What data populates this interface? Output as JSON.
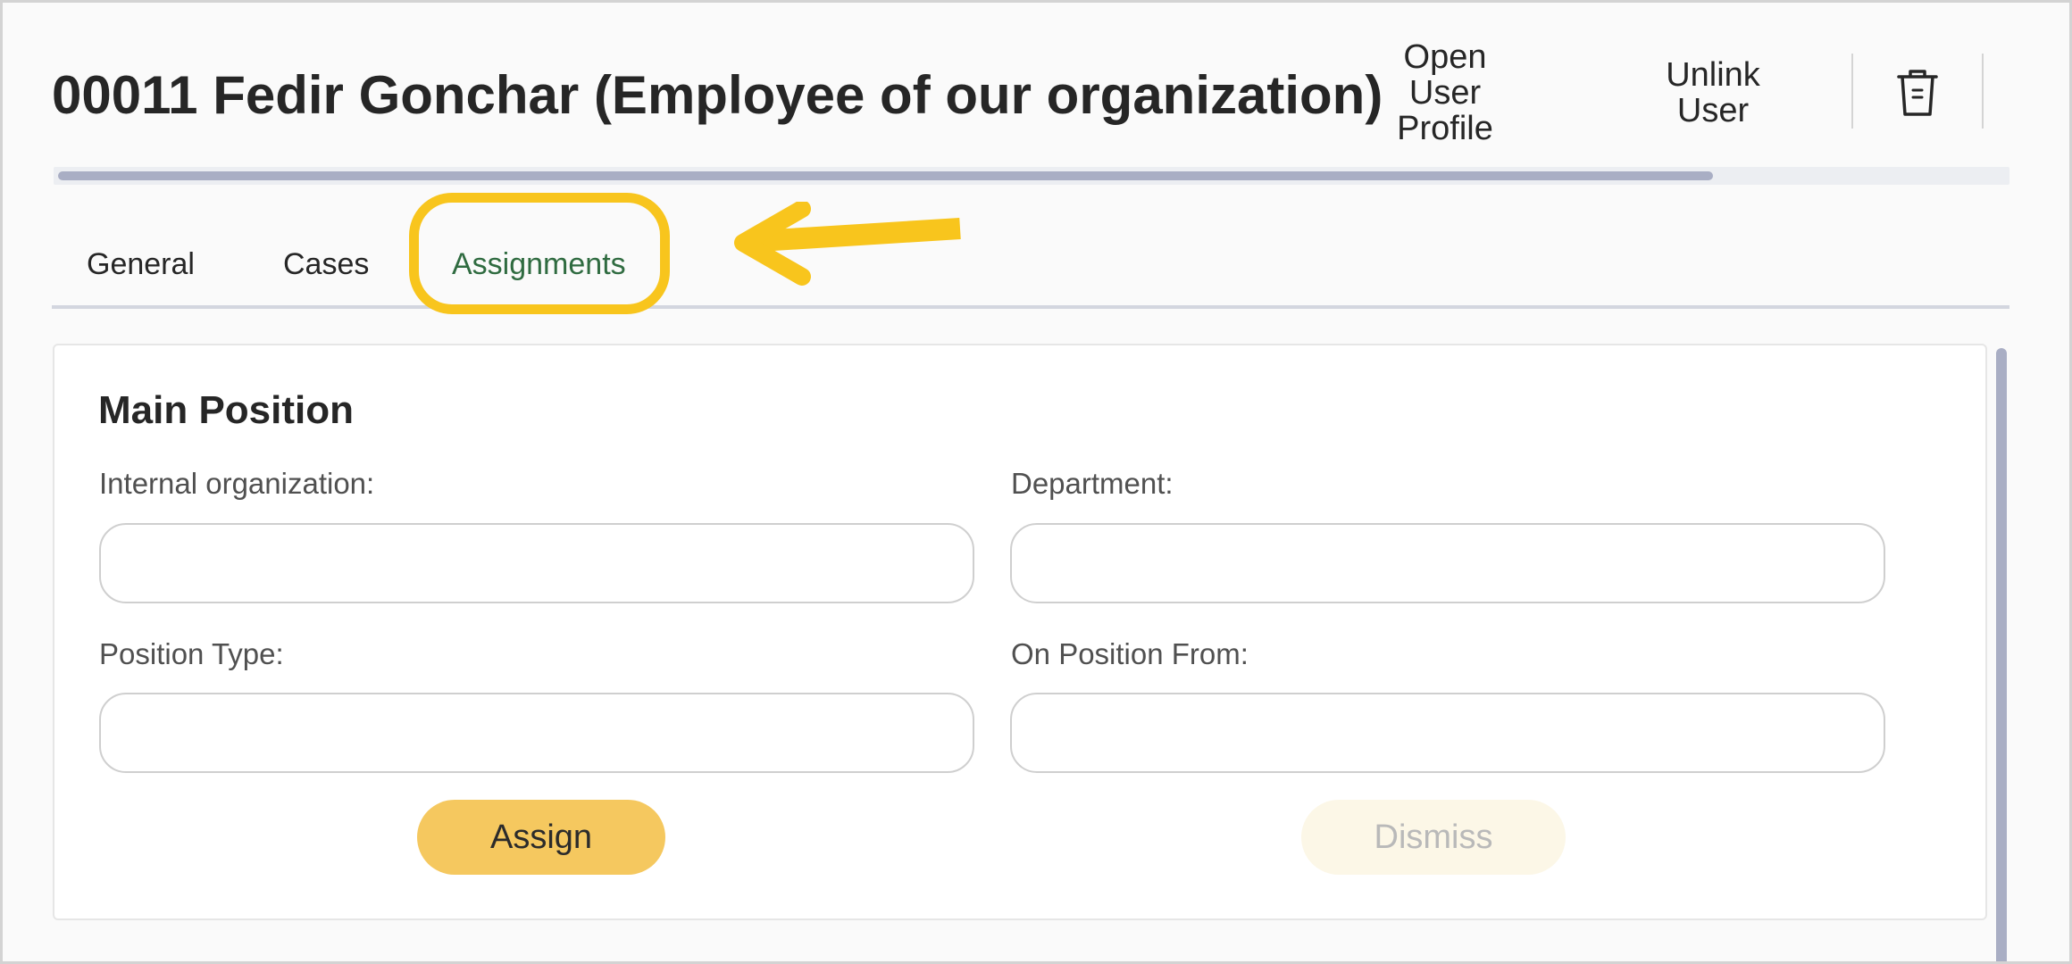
{
  "header": {
    "title": "00011 Fedir Gonchar (Employee of our organization)",
    "open_profile_lines": [
      "Open",
      "User",
      "Profile"
    ],
    "unlink_lines": [
      "Unlink",
      "User"
    ],
    "delete_icon": "trash-icon",
    "progress_fraction": 0.85
  },
  "tabs": [
    {
      "label": "General",
      "active": false
    },
    {
      "label": "Cases",
      "active": false
    },
    {
      "label": "Assignments",
      "active": true
    }
  ],
  "annotation": {
    "highlight_color": "#f8c51d",
    "arrow_icon": "arrow-left-icon"
  },
  "main_position": {
    "section_title": "Main Position",
    "fields": [
      {
        "label": "Internal organization:",
        "value": ""
      },
      {
        "label": "Department:",
        "value": ""
      },
      {
        "label": "Position Type:",
        "value": ""
      },
      {
        "label": "On Position From:",
        "value": ""
      }
    ],
    "assign_label": "Assign",
    "dismiss_label": "Dismiss"
  },
  "colors": {
    "active_tab": "#2f6b40",
    "assign_button": "#f5c85f",
    "dismiss_button": "#fcf7e7"
  }
}
